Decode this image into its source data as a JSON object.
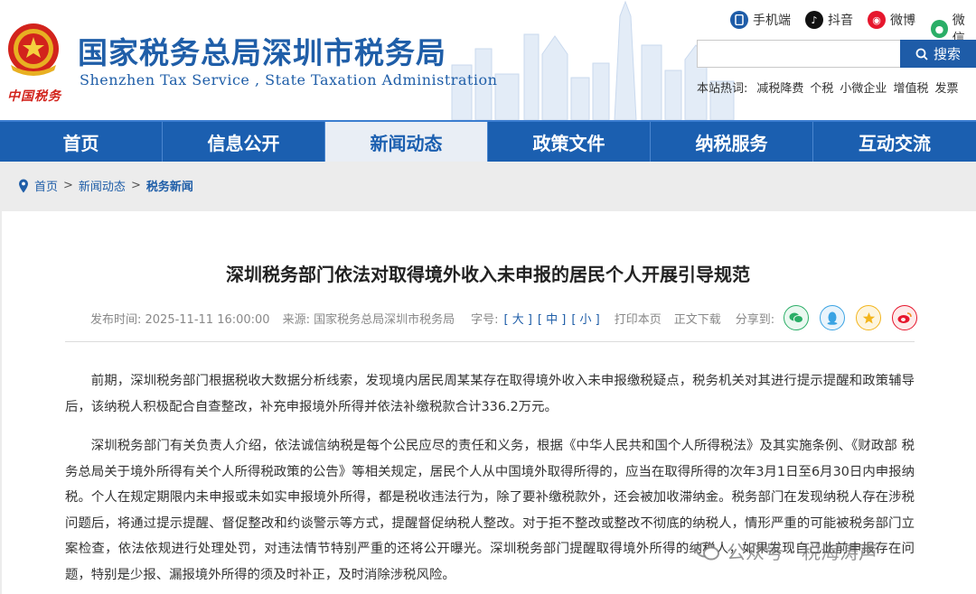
{
  "header": {
    "site_title": "国家税务总局深圳市税务局",
    "site_subtitle": "Shenzhen Tax Service , State Taxation Administration",
    "emblem_caption": "中国税务",
    "social": [
      {
        "label": "手机端",
        "icon": "phone-icon",
        "color": "#1e5ca8"
      },
      {
        "label": "抖音",
        "icon": "douyin-icon",
        "color": "#111111"
      },
      {
        "label": "微博",
        "icon": "weibo-icon",
        "color": "#e6162d"
      },
      {
        "label": "微信",
        "icon": "wechat-icon",
        "color": "#2aae67"
      }
    ],
    "search": {
      "value": "",
      "button": "搜索"
    },
    "hot": {
      "label": "本站热词:",
      "items": [
        "减税降费",
        "个税",
        "小微企业",
        "增值税",
        "发票"
      ]
    }
  },
  "nav": {
    "items": [
      "首页",
      "信息公开",
      "新闻动态",
      "政策文件",
      "纳税服务",
      "互动交流"
    ],
    "active": 2
  },
  "breadcrumb": {
    "home": "首页",
    "level1": "新闻动态",
    "current": "税务新闻",
    "sep": ">"
  },
  "article": {
    "title": "深圳税务部门依法对取得境外收入未申报的居民个人开展引导规范",
    "meta": {
      "date": "发布时间: 2025-11-11 16:00:00",
      "source": "来源: 国家税务总局深圳市税务局",
      "font_label": "字号:",
      "font_large": "[ 大 ]",
      "font_mid": "[ 中 ]",
      "font_small": "[ 小 ]",
      "print": "打印本页",
      "read": "正文下载",
      "share_label": "分享到:"
    },
    "paragraphs": [
      "前期，深圳税务部门根据税收大数据分析线索，发现境内居民周某某存在取得境外收入未申报缴税疑点，税务机关对其进行提示提醒和政策辅导后，该纳税人积极配合自查整改，补充申报境外所得并依法补缴税款合计336.2万元。",
      "深圳税务部门有关负责人介绍，依法诚信纳税是每个公民应尽的责任和义务，根据《中华人民共和国个人所得税法》及其实施条例、《财政部 税务总局关于境外所得有关个人所得税政策的公告》等相关规定，居民个人从中国境外取得所得的，应当在取得所得的次年3月1日至6月30日内申报纳税。个人在规定期限内未申报或未如实申报境外所得，都是税收违法行为，除了要补缴税款外，还会被加收滞纳金。税务部门在发现纳税人存在涉税问题后，将通过提示提醒、督促整改和约谈警示等方式，提醒督促纳税人整改。对于拒不整改或整改不彻底的纳税人，情形严重的可能被税务部门立案检查，依法依规进行处理处罚，对违法情节特别严重的还将公开曝光。深圳税务部门提醒取得境外所得的纳税人，如果发现自己此前申报存在问题，特别是少报、漏报境外所得的须及时补正，及时消除涉税风险。"
    ]
  },
  "watermark": "公众号 · 税海涛声",
  "colors": {
    "brand_blue": "#1b5fb0",
    "title_blue": "#1f5ea8",
    "emblem_red": "#d2231c"
  }
}
